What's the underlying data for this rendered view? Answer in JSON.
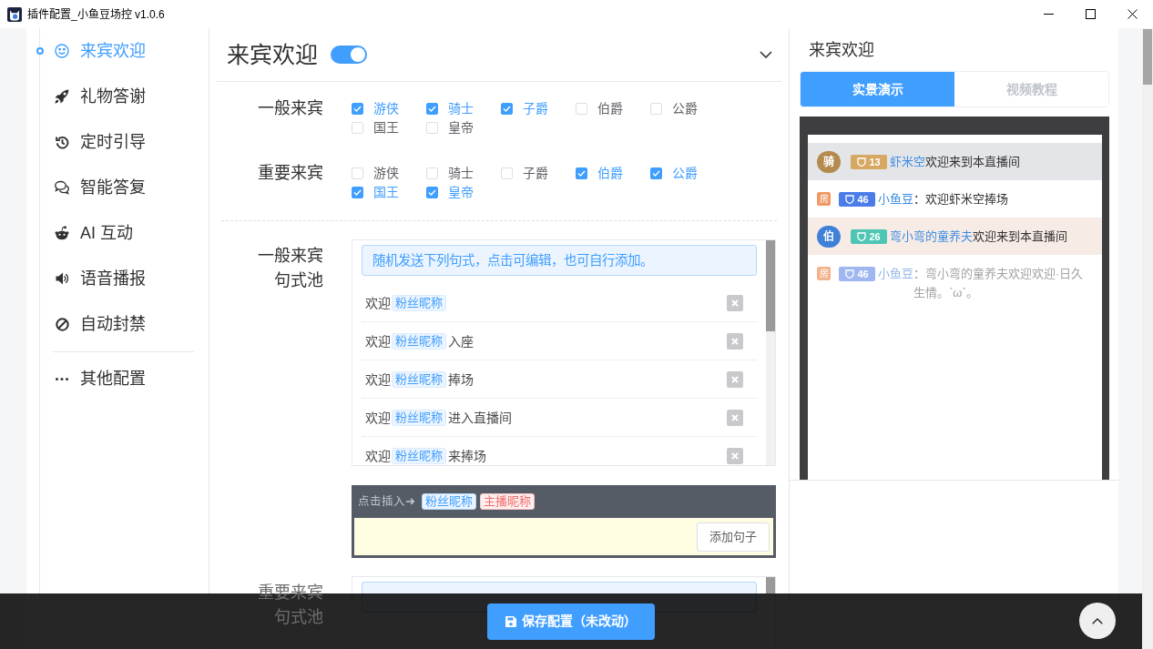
{
  "window": {
    "title": "插件配置_小鱼豆场控 v1.0.6"
  },
  "sidebar": {
    "items": [
      {
        "label": "来宾欢迎",
        "selected": true
      },
      {
        "label": "礼物答谢",
        "selected": false
      },
      {
        "label": "定时引导",
        "selected": false
      },
      {
        "label": "智能答复",
        "selected": false
      },
      {
        "label": "AI 互动",
        "selected": false
      },
      {
        "label": "语音播报",
        "selected": false
      },
      {
        "label": "自动封禁",
        "selected": false
      }
    ],
    "more_items": [
      {
        "label": "其他配置",
        "selected": false
      }
    ]
  },
  "section": {
    "title": "来宾欢迎",
    "enabled": true
  },
  "guest_groups": [
    {
      "label": "一般来宾",
      "options": [
        {
          "label": "游侠",
          "checked": true
        },
        {
          "label": "骑士",
          "checked": true
        },
        {
          "label": "子爵",
          "checked": true
        },
        {
          "label": "伯爵",
          "checked": false
        },
        {
          "label": "公爵",
          "checked": false
        },
        {
          "label": "国王",
          "checked": false
        },
        {
          "label": "皇帝",
          "checked": false
        }
      ]
    },
    {
      "label": "重要来宾",
      "options": [
        {
          "label": "游侠",
          "checked": false
        },
        {
          "label": "骑士",
          "checked": false
        },
        {
          "label": "子爵",
          "checked": false
        },
        {
          "label": "伯爵",
          "checked": true
        },
        {
          "label": "公爵",
          "checked": true
        },
        {
          "label": "国王",
          "checked": true
        },
        {
          "label": "皇帝",
          "checked": true
        }
      ]
    }
  ],
  "sentence_pools": [
    {
      "label": "一般来宾句式池",
      "hint": "随机发送下列句式，点击可编辑，也可自行添加。",
      "sentences": [
        {
          "prefix": "欢迎",
          "tag": "粉丝昵称"
        },
        {
          "prefix": "欢迎",
          "tag": "粉丝昵称",
          "suffix": "入座"
        },
        {
          "prefix": "欢迎",
          "tag": "粉丝昵称",
          "suffix": "捧场"
        },
        {
          "prefix": "欢迎",
          "tag": "粉丝昵称",
          "suffix": "进入直播间"
        },
        {
          "prefix": "欢迎",
          "tag": "粉丝昵称",
          "suffix": "来捧场"
        }
      ],
      "insert_bar": {
        "prompt": "点击插入➜",
        "tags": [
          {
            "text": "粉丝昵称",
            "kind": "fan"
          },
          {
            "text": "主播昵称",
            "kind": "host"
          }
        ],
        "add_button": "添加句子"
      }
    },
    {
      "label": "重要来宾句式池"
    }
  ],
  "save_button": {
    "label": "保存配置（未改动）"
  },
  "preview_panel": {
    "title": "来宾欢迎",
    "tabs": [
      {
        "label": "实景演示",
        "selected": true
      },
      {
        "label": "视频教程",
        "selected": false
      }
    ],
    "messages": [
      {
        "badge": {
          "kind": "noble",
          "text": "骑",
          "color": "#b48a4e"
        },
        "medal": {
          "text": "13",
          "color": "#d6a862"
        },
        "name": "虾米空",
        "text": "欢迎来到本直播间",
        "color": "#e4e5e9",
        "faded": false
      },
      {
        "badge": {
          "kind": "room",
          "text": "房",
          "color": "#ef9a66"
        },
        "medal": {
          "text": "46",
          "color": "#4a7cea"
        },
        "name": "小鱼豆",
        "text": "：欢迎虾米空捧场",
        "faded": false
      },
      {
        "badge": {
          "kind": "noble",
          "text": "伯",
          "color": "#3f80d8"
        },
        "medal": {
          "text": "26",
          "color": "#4fc6b4"
        },
        "name": "弯小弯的童养夫",
        "text": "欢迎来到本直播间",
        "color": "#f7ebe6",
        "faded": false
      },
      {
        "badge": {
          "kind": "room",
          "text": "房",
          "color": "#f2b48e"
        },
        "medal": {
          "text": "46",
          "color": "#9fb7f0"
        },
        "name": "小鱼豆",
        "text": "：弯小弯的童养夫欢迎欢迎·日久生情。ˊωˋ。",
        "faded": true
      }
    ]
  }
}
